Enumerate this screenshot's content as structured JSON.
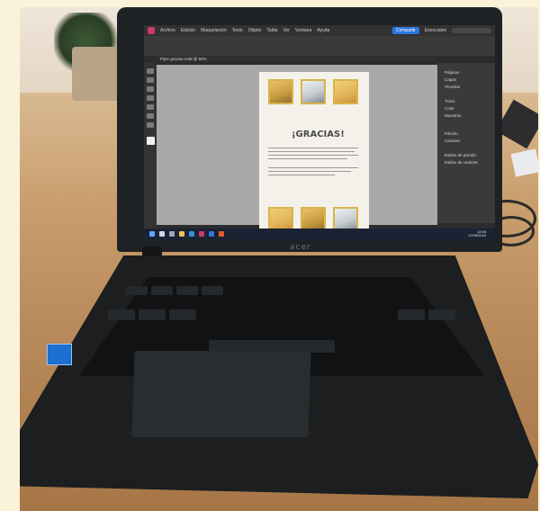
{
  "screen": {
    "menubar": {
      "items": [
        "Archivo",
        "Edición",
        "Maquetación",
        "Texto",
        "Objeto",
        "Tabla",
        "Ver",
        "Ventana",
        "Ayuda"
      ],
      "share_label": "Compartir",
      "workspace_label": "Esenciales"
    },
    "document": {
      "tab_label": "Flyer gracias.indd @ 50%",
      "heading": "¡GRACIAS!"
    },
    "right_panel": {
      "items": [
        "Páginas",
        "Capas",
        "Vínculos",
        "Trazo",
        "Color",
        "Muestras",
        "Párrafo",
        "Carácter",
        "Estilos de párrafo",
        "Estilos de carácter"
      ]
    },
    "taskbar": {
      "time": "12:06",
      "date": "17/05/2024"
    }
  },
  "laptop": {
    "brand": "acer"
  },
  "colors": {
    "accent": "#2c75e0",
    "app_icon": "#c83a6a",
    "thumbnail_border": "#d7b54a",
    "table": "#c99d6d"
  }
}
